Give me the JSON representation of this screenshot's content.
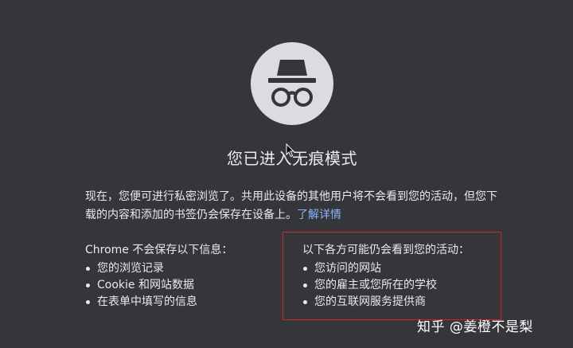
{
  "page": {
    "title": "您已进入无痕模式",
    "intro_text": "现在，您便可进行私密浏览了。共用此设备的其他用户将不会看到您的活动，但您下载的内容和添加的书签仍会保存在设备上。",
    "learn_more_label": "了解详情"
  },
  "columns": {
    "not_saved": {
      "heading": "Chrome 不会保存以下信息：",
      "items": [
        "您的浏览记录",
        "Cookie 和网站数据",
        "在表单中填写的信息"
      ]
    },
    "visible_to": {
      "heading": "以下各方可能仍会看到您的活动：",
      "items": [
        "您访问的网站",
        "您的雇主或您所在的学校",
        "您的互联网服务提供商"
      ]
    }
  },
  "watermark": {
    "text": "知乎 @姜橙不是梨"
  },
  "colors": {
    "background": "#35363a",
    "text": "#e8eaed",
    "link": "#8ab4f8",
    "icon_circle": "#dadce0",
    "icon_glyph": "#35363a",
    "annotation_box": "#c8262a"
  },
  "icons": {
    "incognito": "incognito-icon",
    "cursor": "mouse-pointer-icon"
  }
}
